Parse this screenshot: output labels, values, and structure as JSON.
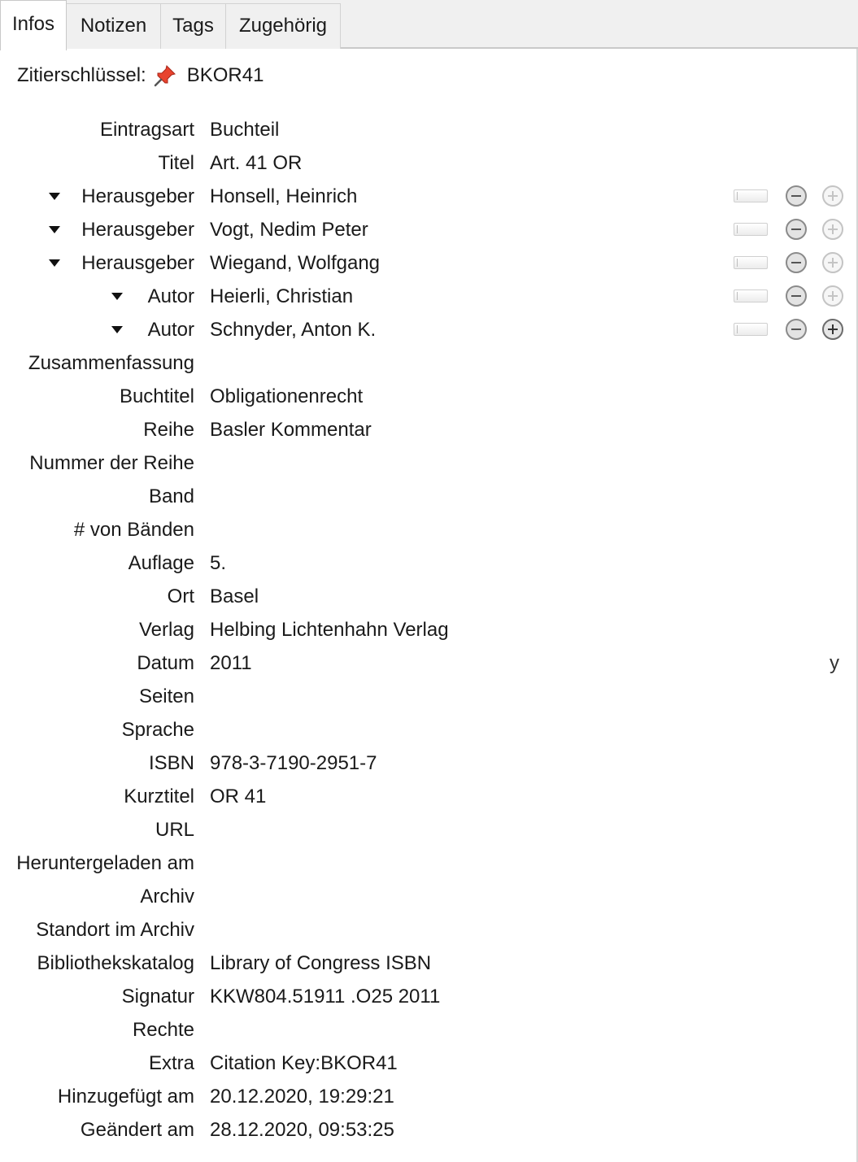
{
  "tabs": [
    {
      "label": "Infos"
    },
    {
      "label": "Notizen"
    },
    {
      "label": "Tags"
    },
    {
      "label": "Zugehörig"
    }
  ],
  "citation_key": {
    "label": "Zitierschlüssel:",
    "icon": "pin-icon",
    "value": "BKOR41"
  },
  "fields": [
    {
      "label": "Eintragsart",
      "value": "Buchteil"
    },
    {
      "label": "Titel",
      "value": "Art. 41 OR"
    },
    {
      "label": "Herausgeber",
      "value": "Honsell, Heinrich"
    },
    {
      "label": "Herausgeber",
      "value": "Vogt, Nedim Peter"
    },
    {
      "label": "Herausgeber",
      "value": "Wiegand, Wolfgang"
    },
    {
      "label": "Autor",
      "value": "Heierli, Christian"
    },
    {
      "label": "Autor",
      "value": "Schnyder, Anton K."
    },
    {
      "label": "Zusammenfassung",
      "value": ""
    },
    {
      "label": "Buchtitel",
      "value": "Obligationenrecht"
    },
    {
      "label": "Reihe",
      "value": "Basler Kommentar"
    },
    {
      "label": "Nummer der Reihe",
      "value": ""
    },
    {
      "label": "Band",
      "value": ""
    },
    {
      "label": "# von Bänden",
      "value": ""
    },
    {
      "label": "Auflage",
      "value": "5."
    },
    {
      "label": "Ort",
      "value": "Basel"
    },
    {
      "label": "Verlag",
      "value": "Helbing Lichtenhahn Verlag"
    },
    {
      "label": "Datum",
      "value": "2011",
      "date_format": "y"
    },
    {
      "label": "Seiten",
      "value": ""
    },
    {
      "label": "Sprache",
      "value": ""
    },
    {
      "label": "ISBN",
      "value": "978-3-7190-2951-7"
    },
    {
      "label": "Kurztitel",
      "value": "OR 41"
    },
    {
      "label": "URL",
      "value": ""
    },
    {
      "label": "Heruntergeladen am",
      "value": ""
    },
    {
      "label": "Archiv",
      "value": ""
    },
    {
      "label": "Standort im Archiv",
      "value": ""
    },
    {
      "label": "Bibliothekskatalog",
      "value": "Library of Congress ISBN"
    },
    {
      "label": "Signatur",
      "value": "KKW804.51911 .O25 2011"
    },
    {
      "label": "Rechte",
      "value": ""
    },
    {
      "label": "Extra",
      "value": "Citation Key:BKOR41"
    },
    {
      "label": "Hinzugefügt am",
      "value": "20.12.2020, 19:29:21"
    },
    {
      "label": "Geändert am",
      "value": "28.12.2020, 09:53:25"
    }
  ],
  "colors": {
    "pin": "#e8432e",
    "tab_bar": "#f0f0f0",
    "text": "#1a1a1a"
  }
}
